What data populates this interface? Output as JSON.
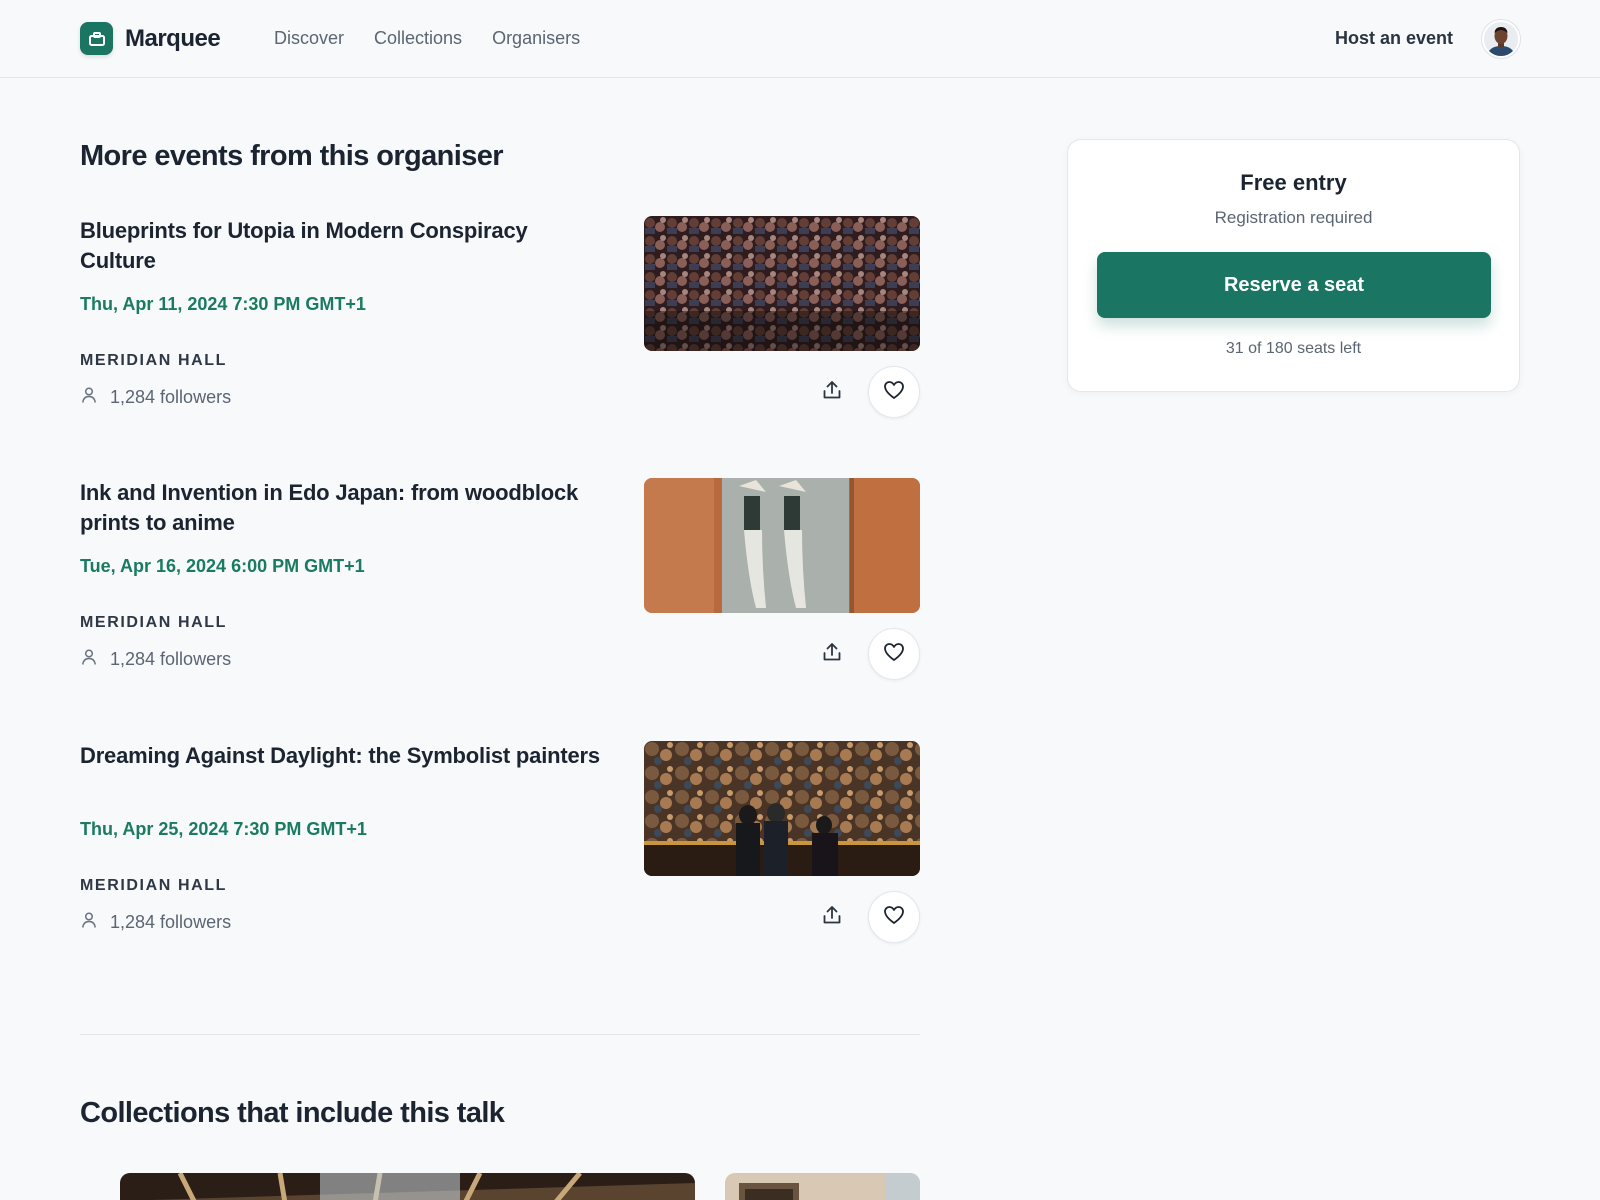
{
  "header": {
    "brand": "Marquee",
    "nav": [
      "Discover",
      "Collections",
      "Organisers"
    ],
    "host_label": "Host an event"
  },
  "more_events": {
    "title": "More events from this organiser",
    "items": [
      {
        "title": "Blueprints for Utopia in Modern Conspiracy Culture",
        "date": "Thu, Apr 11, 2024 7:30 PM GMT+1",
        "organiser": "MERIDIAN HALL",
        "followers": "1,284 followers"
      },
      {
        "title": "Ink and Invention in Edo Japan: from woodblock prints to anime",
        "date": "Tue, Apr 16, 2024 6:00 PM GMT+1",
        "organiser": "MERIDIAN HALL",
        "followers": "1,284 followers"
      },
      {
        "title": "Dreaming Against Daylight: the Symbolist painters",
        "date": "Thu, Apr 25, 2024 7:30 PM GMT+1",
        "organiser": "MERIDIAN HALL",
        "followers": "1,284 followers"
      }
    ]
  },
  "collections": {
    "title": "Collections that include this talk"
  },
  "ticket": {
    "price": "Free entry",
    "note": "Registration required",
    "cta": "Reserve a seat",
    "seats": "31 of 180 seats left"
  },
  "colors": {
    "accent": "#1a7563",
    "date": "#1a7a62",
    "background": "#f7f9fb"
  },
  "icons": [
    "calendar-icon",
    "user-icon",
    "share-icon",
    "heart-icon"
  ]
}
